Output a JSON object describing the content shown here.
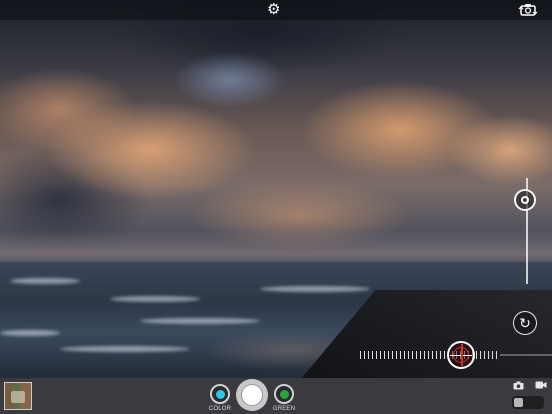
{
  "topbar": {
    "settings_icon": "gear-icon",
    "switch_camera_icon": "camera-rotate-icon"
  },
  "viewfinder": {
    "zoom_slider_level": 0.15,
    "exposure_level": 0.72
  },
  "bottombar": {
    "left_filter": {
      "label": "COLOR",
      "color": "#2ec7e6"
    },
    "right_filter": {
      "label": "GREEN",
      "color": "#2aa43a"
    },
    "shutter_icon": "shutter-icon",
    "photo_mode_icon": "camera-icon",
    "video_mode_icon": "video-camera-icon"
  },
  "colors": {
    "toolbar_bg": "#3a3b3e",
    "exposure_accent": "#e02a2a"
  }
}
